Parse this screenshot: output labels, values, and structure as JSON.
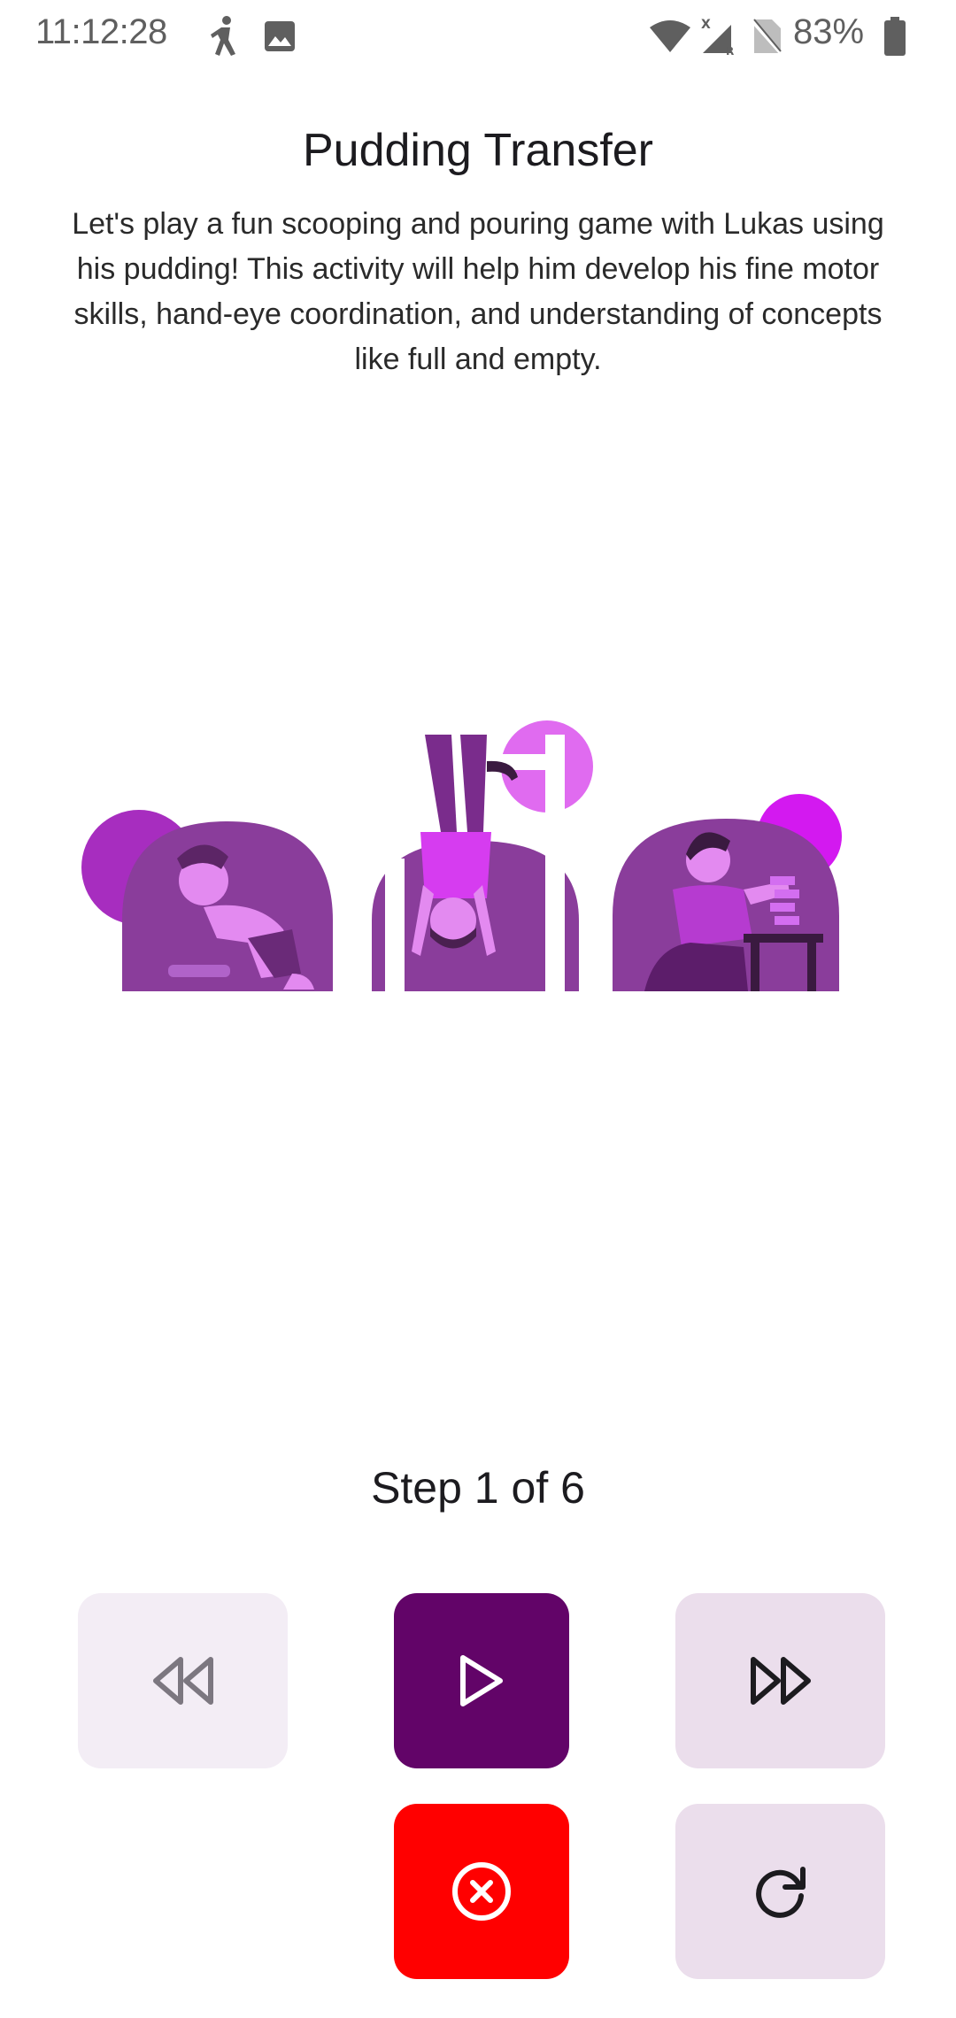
{
  "status_bar": {
    "time": "11:12:28",
    "battery_percent": "83%",
    "icons": [
      "walking-icon",
      "image-icon",
      "wifi-icon",
      "signal-icon",
      "no-sim-icon",
      "battery-icon"
    ]
  },
  "activity": {
    "title": "Pudding Transfer",
    "description": "Let's play a fun scooping and pouring game with Lukas using his pudding! This activity will help him develop his fine motor skills, hand-eye coordination, and understanding of concepts like full and empty."
  },
  "progress": {
    "label": "Step 1 of 6",
    "current_step": 1,
    "total_steps": 6
  },
  "controls": {
    "rewind_icon": "rewind-icon",
    "play_icon": "play-icon",
    "forward_icon": "fast-forward-icon",
    "close_icon": "close-circle-icon",
    "restart_icon": "restart-icon"
  },
  "colors": {
    "primary": "#620468",
    "danger": "#ff0000",
    "button_light": "#ebdeec",
    "button_disabled": "#f3edf5",
    "illustration_dark": "#8a3d9b",
    "illustration_accent": "#e06bf0"
  }
}
